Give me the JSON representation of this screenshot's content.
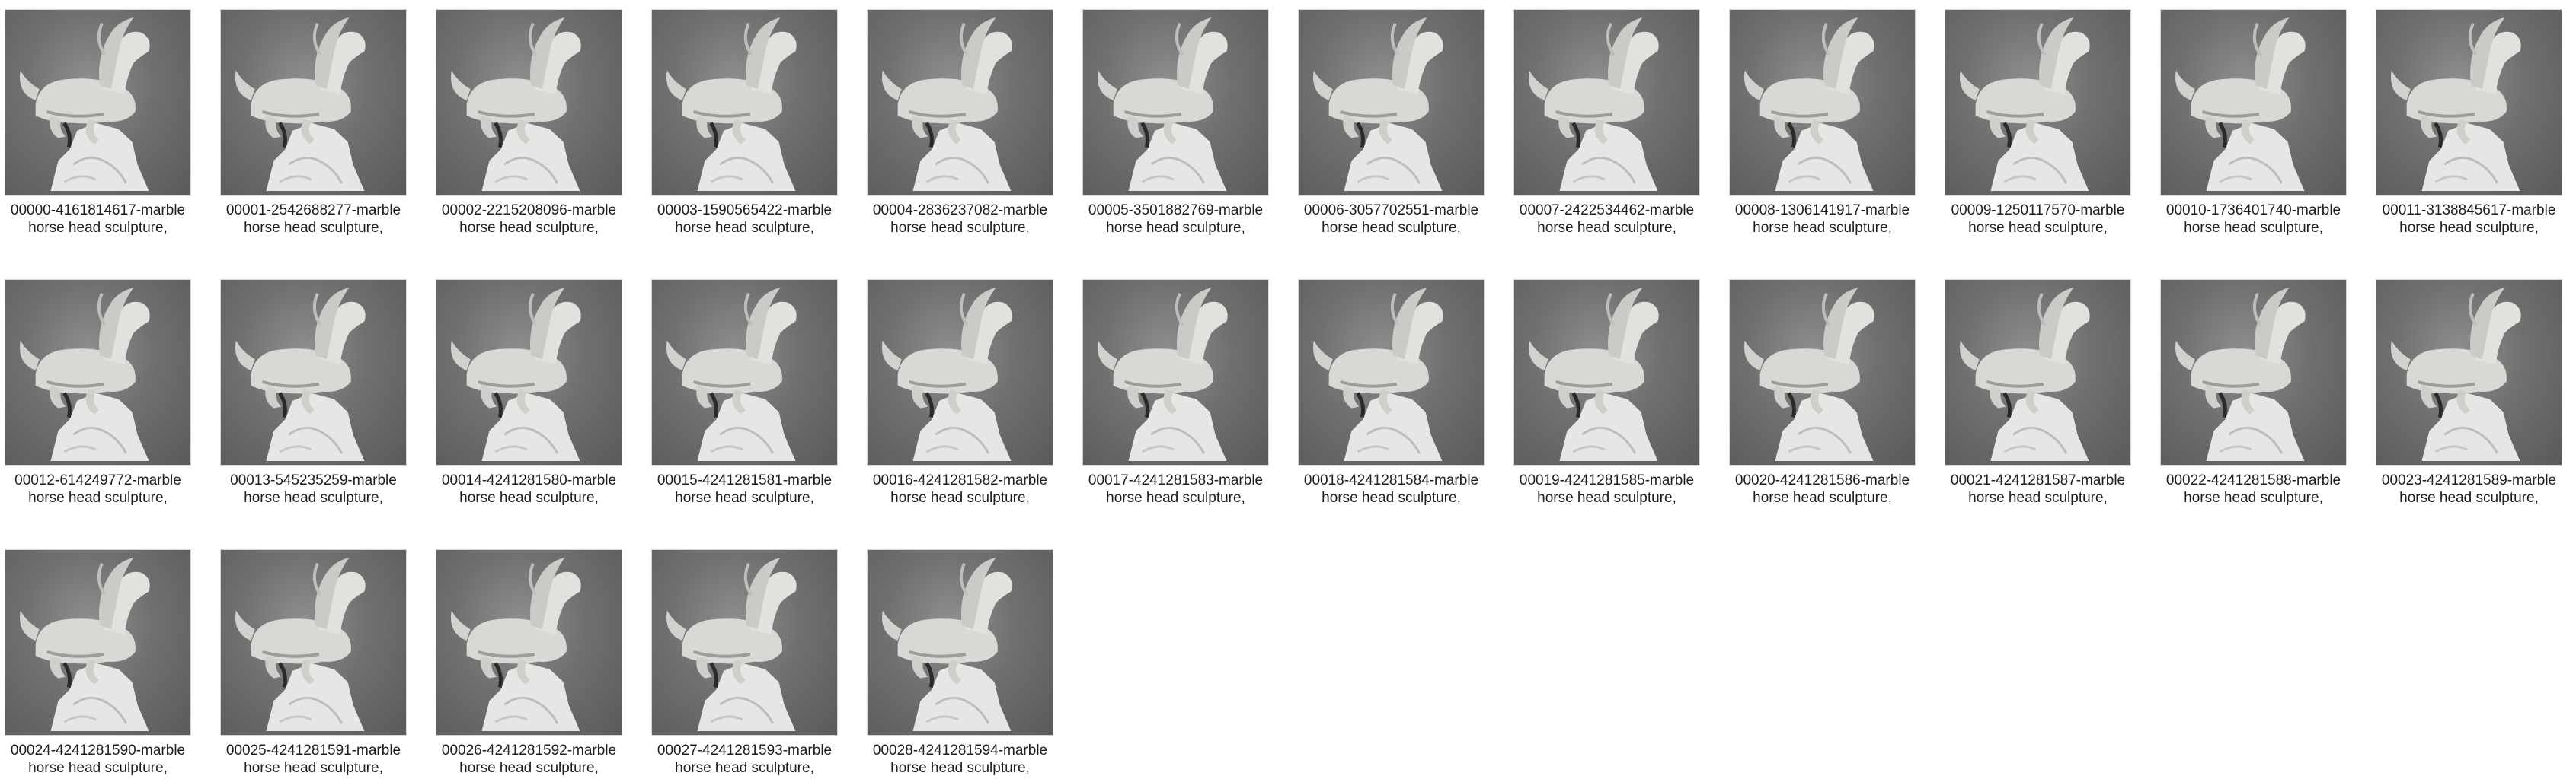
{
  "icon": "marble-horse-sculpture-thumbnail",
  "files": [
    {
      "line1": "00000-4161814617-marble",
      "line2": "horse head sculpture,"
    },
    {
      "line1": "00001-2542688277-marble",
      "line2": "horse head sculpture,"
    },
    {
      "line1": "00002-2215208096-marble",
      "line2": "horse head sculpture,"
    },
    {
      "line1": "00003-1590565422-marble",
      "line2": "horse head sculpture,"
    },
    {
      "line1": "00004-2836237082-marble",
      "line2": "horse head sculpture,"
    },
    {
      "line1": "00005-3501882769-marble",
      "line2": "horse head sculpture,"
    },
    {
      "line1": "00006-3057702551-marble",
      "line2": "horse head sculpture,"
    },
    {
      "line1": "00007-2422534462-marble",
      "line2": "horse head sculpture,"
    },
    {
      "line1": "00008-1306141917-marble",
      "line2": "horse head sculpture,"
    },
    {
      "line1": "00009-1250117570-marble",
      "line2": "horse head sculpture,"
    },
    {
      "line1": "00010-1736401740-marble",
      "line2": "horse head sculpture,"
    },
    {
      "line1": "00011-3138845617-marble",
      "line2": "horse head sculpture,"
    },
    {
      "line1": "00012-614249772-marble",
      "line2": "horse head sculpture,"
    },
    {
      "line1": "00013-545235259-marble",
      "line2": "horse head sculpture,"
    },
    {
      "line1": "00014-4241281580-marble",
      "line2": "horse head sculpture,"
    },
    {
      "line1": "00015-4241281581-marble",
      "line2": "horse head sculpture,"
    },
    {
      "line1": "00016-4241281582-marble",
      "line2": "horse head sculpture,"
    },
    {
      "line1": "00017-4241281583-marble",
      "line2": "horse head sculpture,"
    },
    {
      "line1": "00018-4241281584-marble",
      "line2": "horse head sculpture,"
    },
    {
      "line1": "00019-4241281585-marble",
      "line2": "horse head sculpture,"
    },
    {
      "line1": "00020-4241281586-marble",
      "line2": "horse head sculpture,"
    },
    {
      "line1": "00021-4241281587-marble",
      "line2": "horse head sculpture,"
    },
    {
      "line1": "00022-4241281588-marble",
      "line2": "horse head sculpture,"
    },
    {
      "line1": "00023-4241281589-marble",
      "line2": "horse head sculpture,"
    },
    {
      "line1": "00024-4241281590-marble",
      "line2": "horse head sculpture,"
    },
    {
      "line1": "00025-4241281591-marble",
      "line2": "horse head sculpture,"
    },
    {
      "line1": "00026-4241281592-marble",
      "line2": "horse head sculpture,"
    },
    {
      "line1": "00027-4241281593-marble",
      "line2": "horse head sculpture,"
    },
    {
      "line1": "00028-4241281594-marble",
      "line2": "horse head sculpture,"
    }
  ]
}
